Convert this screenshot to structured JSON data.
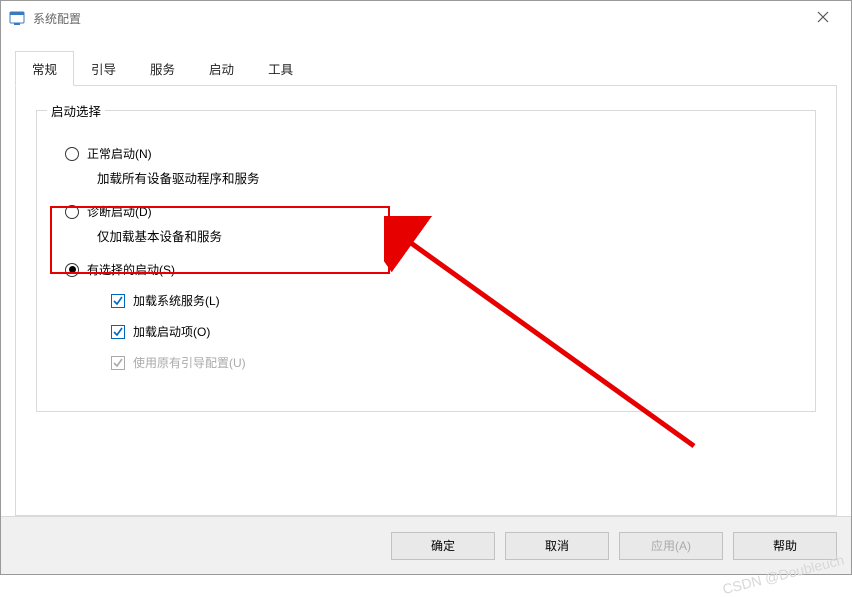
{
  "window": {
    "title": "系统配置"
  },
  "tabs": [
    {
      "label": "常规",
      "active": true
    },
    {
      "label": "引导",
      "active": false
    },
    {
      "label": "服务",
      "active": false
    },
    {
      "label": "启动",
      "active": false
    },
    {
      "label": "工具",
      "active": false
    }
  ],
  "groupbox": {
    "label": "启动选择",
    "options": [
      {
        "label": "正常启动(N)",
        "desc": "加载所有设备驱动程序和服务",
        "checked": false
      },
      {
        "label": "诊断启动(D)",
        "desc": "仅加载基本设备和服务",
        "checked": false
      },
      {
        "label": "有选择的启动(S)",
        "desc": "",
        "checked": true
      }
    ],
    "sub_checks": [
      {
        "label": "加载系统服务(L)",
        "checked": true,
        "disabled": false
      },
      {
        "label": "加载启动项(O)",
        "checked": true,
        "disabled": false
      },
      {
        "label": "使用原有引导配置(U)",
        "checked": true,
        "disabled": true
      }
    ]
  },
  "buttons": {
    "ok": "确定",
    "cancel": "取消",
    "apply": "应用(A)",
    "help": "帮助"
  },
  "watermark": "CSDN @Doubleuch"
}
